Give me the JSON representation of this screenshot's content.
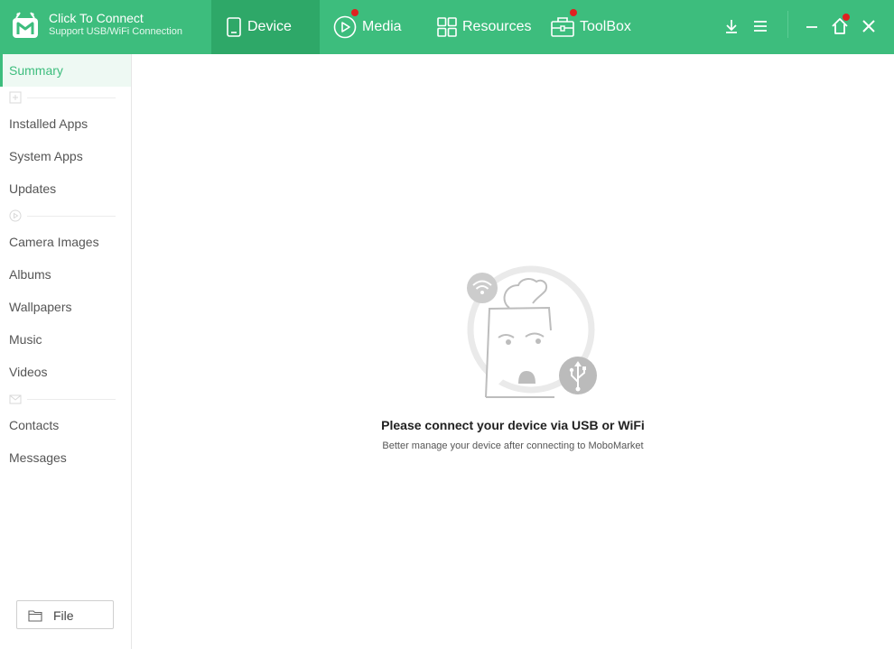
{
  "header": {
    "connect_title": "Click To Connect",
    "connect_subtitle": "Support USB/WiFi Connection",
    "tabs": [
      {
        "label": "Device",
        "icon": "phone-icon",
        "active": true,
        "badge": false
      },
      {
        "label": "Media",
        "icon": "play-circle-icon",
        "active": false,
        "badge": true
      },
      {
        "label": "Resources",
        "icon": "grid-icon",
        "active": false,
        "badge": false
      },
      {
        "label": "ToolBox",
        "icon": "toolbox-icon",
        "active": false,
        "badge": true
      }
    ],
    "controls": [
      "download-icon",
      "menu-icon",
      "minimize-icon",
      "home-icon",
      "close-icon"
    ],
    "accent_color": "#3dbd7d",
    "active_tab_color": "#2ea868",
    "badge_color": "#e02020"
  },
  "sidebar": {
    "summary": "Summary",
    "apps": [
      "Installed Apps",
      "System Apps",
      "Updates"
    ],
    "media": [
      "Camera Images",
      "Albums",
      "Wallpapers",
      "Music",
      "Videos"
    ],
    "messages": [
      "Contacts",
      "Messages"
    ],
    "section_icons": [
      "apps-icon",
      "play-icon",
      "mail-icon"
    ],
    "file_button": "File"
  },
  "main": {
    "empty_title": "Please connect your device via USB or WiFi",
    "empty_subtitle": "Better manage your device after connecting to MoboMarket",
    "illustration_icons": [
      "wifi-icon",
      "usb-icon"
    ]
  }
}
